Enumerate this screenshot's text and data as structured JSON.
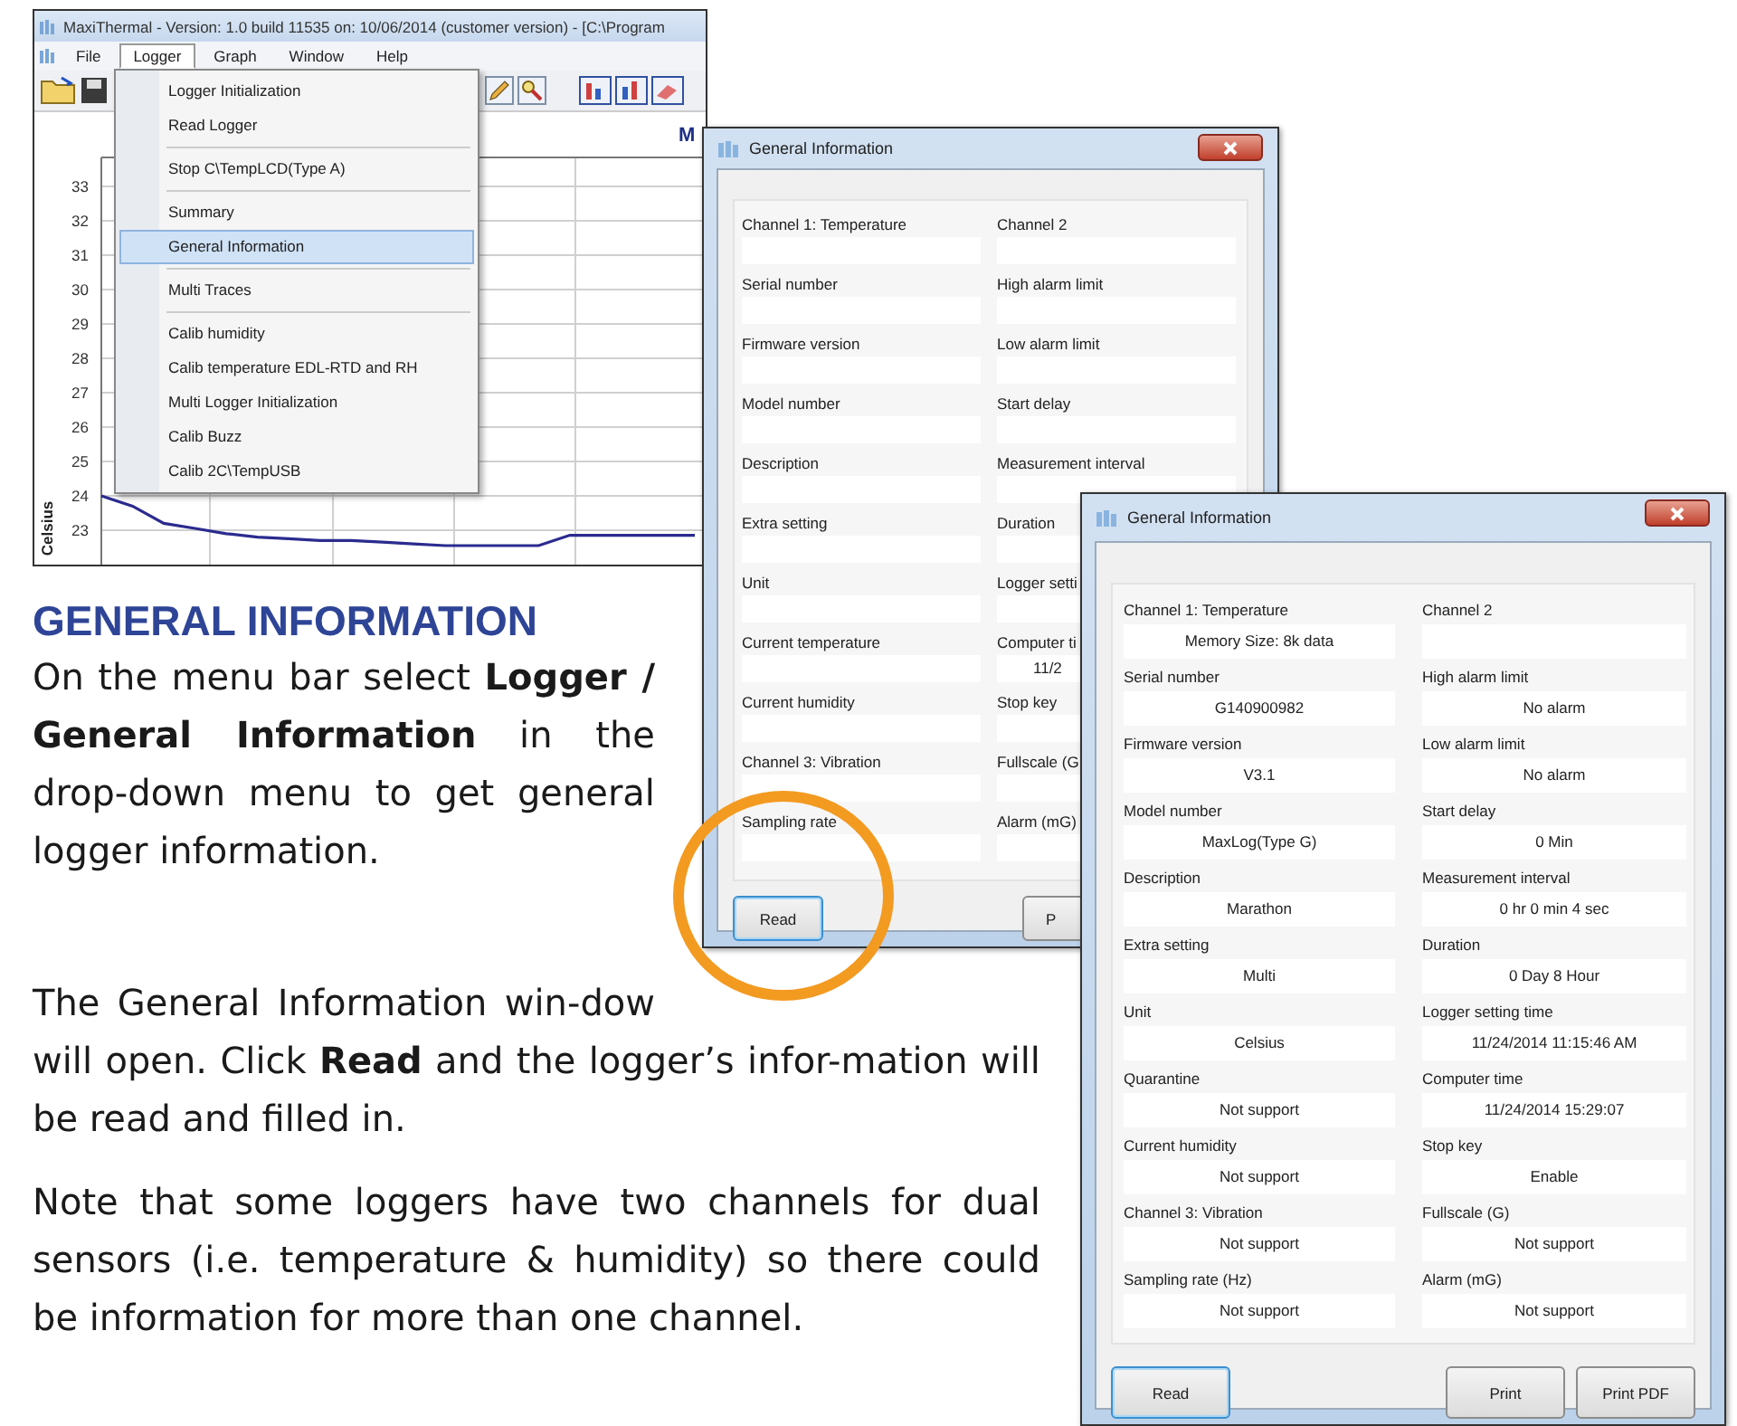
{
  "app_window": {
    "title": "MaxiThermal - Version: 1.0 build 11535 on: 10/06/2014 (customer version) - [C:\\Program",
    "menu": [
      {
        "label": "File",
        "selected": false
      },
      {
        "label": "Logger",
        "selected": true
      },
      {
        "label": "Graph",
        "selected": false
      },
      {
        "label": "Window",
        "selected": false
      },
      {
        "label": "Help",
        "selected": false
      }
    ],
    "chart_title": "M",
    "chart_data": {
      "type": "line",
      "ylabel": "Celsius",
      "grid": true,
      "yticks": [
        33,
        32,
        31,
        30,
        29,
        28,
        27,
        26,
        25,
        24,
        23
      ],
      "ylim": [
        21.9,
        33.84
      ],
      "series": [
        {
          "color": "#2b2b8f",
          "values": [
            24,
            23.7,
            23.2,
            23.05,
            22.9,
            22.8,
            22.75,
            22.7,
            22.7,
            22.65,
            22.6,
            22.55,
            22.55,
            22.55,
            22.55,
            22.85,
            22.85,
            22.85,
            22.85,
            22.85
          ]
        }
      ]
    }
  },
  "logger_menu": {
    "groups": [
      [
        {
          "label": "Logger Initialization",
          "selected": false
        },
        {
          "label": "Read Logger",
          "selected": false
        }
      ],
      [
        {
          "label": "Stop C\\TempLCD(Type A)",
          "selected": false
        }
      ],
      [
        {
          "label": "Summary",
          "selected": false
        },
        {
          "label": "General Information",
          "selected": true
        }
      ],
      [
        {
          "label": "Multi Traces",
          "selected": false
        }
      ],
      [
        {
          "label": "Calib humidity",
          "selected": false
        },
        {
          "label": "Calib temperature EDL-RTD and RH",
          "selected": false
        },
        {
          "label": "Multi Logger Initialization",
          "selected": false
        },
        {
          "label": "Calib Buzz",
          "selected": false
        },
        {
          "label": "Calib 2C\\TempUSB",
          "selected": false
        }
      ]
    ]
  },
  "dialog_back": {
    "title": "General Information",
    "rows": [
      {
        "left": {
          "label": "Channel 1: Temperature"
        },
        "right": {
          "label": "Channel 2"
        }
      },
      {
        "left": {
          "label": "Serial number"
        },
        "right": {
          "label": "High alarm limit"
        }
      },
      {
        "left": {
          "label": "Firmware version"
        },
        "right": {
          "label": "Low alarm limit"
        }
      },
      {
        "left": {
          "label": "Model number"
        },
        "right": {
          "label": "Start delay"
        }
      },
      {
        "left": {
          "label": "Description"
        },
        "right": {
          "label": "Measurement interval"
        }
      },
      {
        "left": {
          "label": "Extra setting"
        },
        "right": {
          "label": "Duration"
        }
      },
      {
        "left": {
          "label": "Unit"
        },
        "right": {
          "label": "Logger setti"
        }
      },
      {
        "left": {
          "label": "Current temperature"
        },
        "right": {
          "label": "Computer ti",
          "value": "11/2"
        }
      },
      {
        "left": {
          "label": "Current humidity"
        },
        "right": {
          "label": "Stop key"
        }
      },
      {
        "left": {
          "label": "Channel 3: Vibration"
        },
        "right": {
          "label": "Fullscale (G"
        }
      },
      {
        "left": {
          "label": "Sampling rate"
        },
        "right": {
          "label": "Alarm (mG)"
        }
      }
    ],
    "buttons": [
      {
        "label": "Read",
        "focused": true
      },
      {
        "label": "P",
        "focused": false
      }
    ]
  },
  "dialog_front": {
    "title": "General Information",
    "rows": [
      {
        "left": {
          "label": "Channel 1: Temperature",
          "value": "Memory Size: 8k data"
        },
        "right": {
          "label": "Channel 2"
        }
      },
      {
        "left": {
          "label": "Serial number",
          "value": "G140900982"
        },
        "right": {
          "label": "High alarm limit",
          "value": "No alarm"
        }
      },
      {
        "left": {
          "label": "Firmware version",
          "value": "V3.1"
        },
        "right": {
          "label": "Low alarm limit",
          "value": "No alarm"
        }
      },
      {
        "left": {
          "label": "Model number",
          "value": "MaxLog(Type G)"
        },
        "right": {
          "label": "Start delay",
          "value": "0 Min"
        }
      },
      {
        "left": {
          "label": "Description",
          "value": "Marathon"
        },
        "right": {
          "label": "Measurement interval",
          "value": "0 hr 0 min 4 sec"
        }
      },
      {
        "left": {
          "label": "Extra setting",
          "value": "Multi"
        },
        "right": {
          "label": "Duration",
          "value": "0 Day 8 Hour"
        }
      },
      {
        "left": {
          "label": "Unit",
          "value": "Celsius"
        },
        "right": {
          "label": "Logger setting time",
          "value": "11/24/2014 11:15:46 AM"
        }
      },
      {
        "left": {
          "label": "Quarantine",
          "value": "Not support"
        },
        "right": {
          "label": "Computer time",
          "value": "11/24/2014 15:29:07"
        }
      },
      {
        "left": {
          "label": "Current humidity",
          "value": "Not support"
        },
        "right": {
          "label": "Stop key",
          "value": "Enable"
        }
      },
      {
        "left": {
          "label": "Channel 3: Vibration",
          "value": "Not support"
        },
        "right": {
          "label": "Fullscale (G)",
          "value": "Not support"
        }
      },
      {
        "left": {
          "label": "Sampling rate (Hz)",
          "value": "Not support"
        },
        "right": {
          "label": "Alarm (mG)",
          "value": "Not support"
        }
      }
    ],
    "buttons": [
      {
        "label": "Read",
        "focused": true
      },
      {
        "label": "Print",
        "focused": false
      },
      {
        "label": "Print PDF",
        "focused": false
      }
    ]
  },
  "article": {
    "heading": "GENERAL INFORMATION",
    "paragraphs": [
      "On the menu bar select **Logger / General Information** in the drop-down menu to get general logger information.",
      "The General Information win-dow will open. Click **Read** and the logger’s infor-mation will be read and filled in.",
      "Note that some loggers have two channels for dual sensors (i.e. temperature & humidity) so there could be information for more than one channel."
    ]
  }
}
